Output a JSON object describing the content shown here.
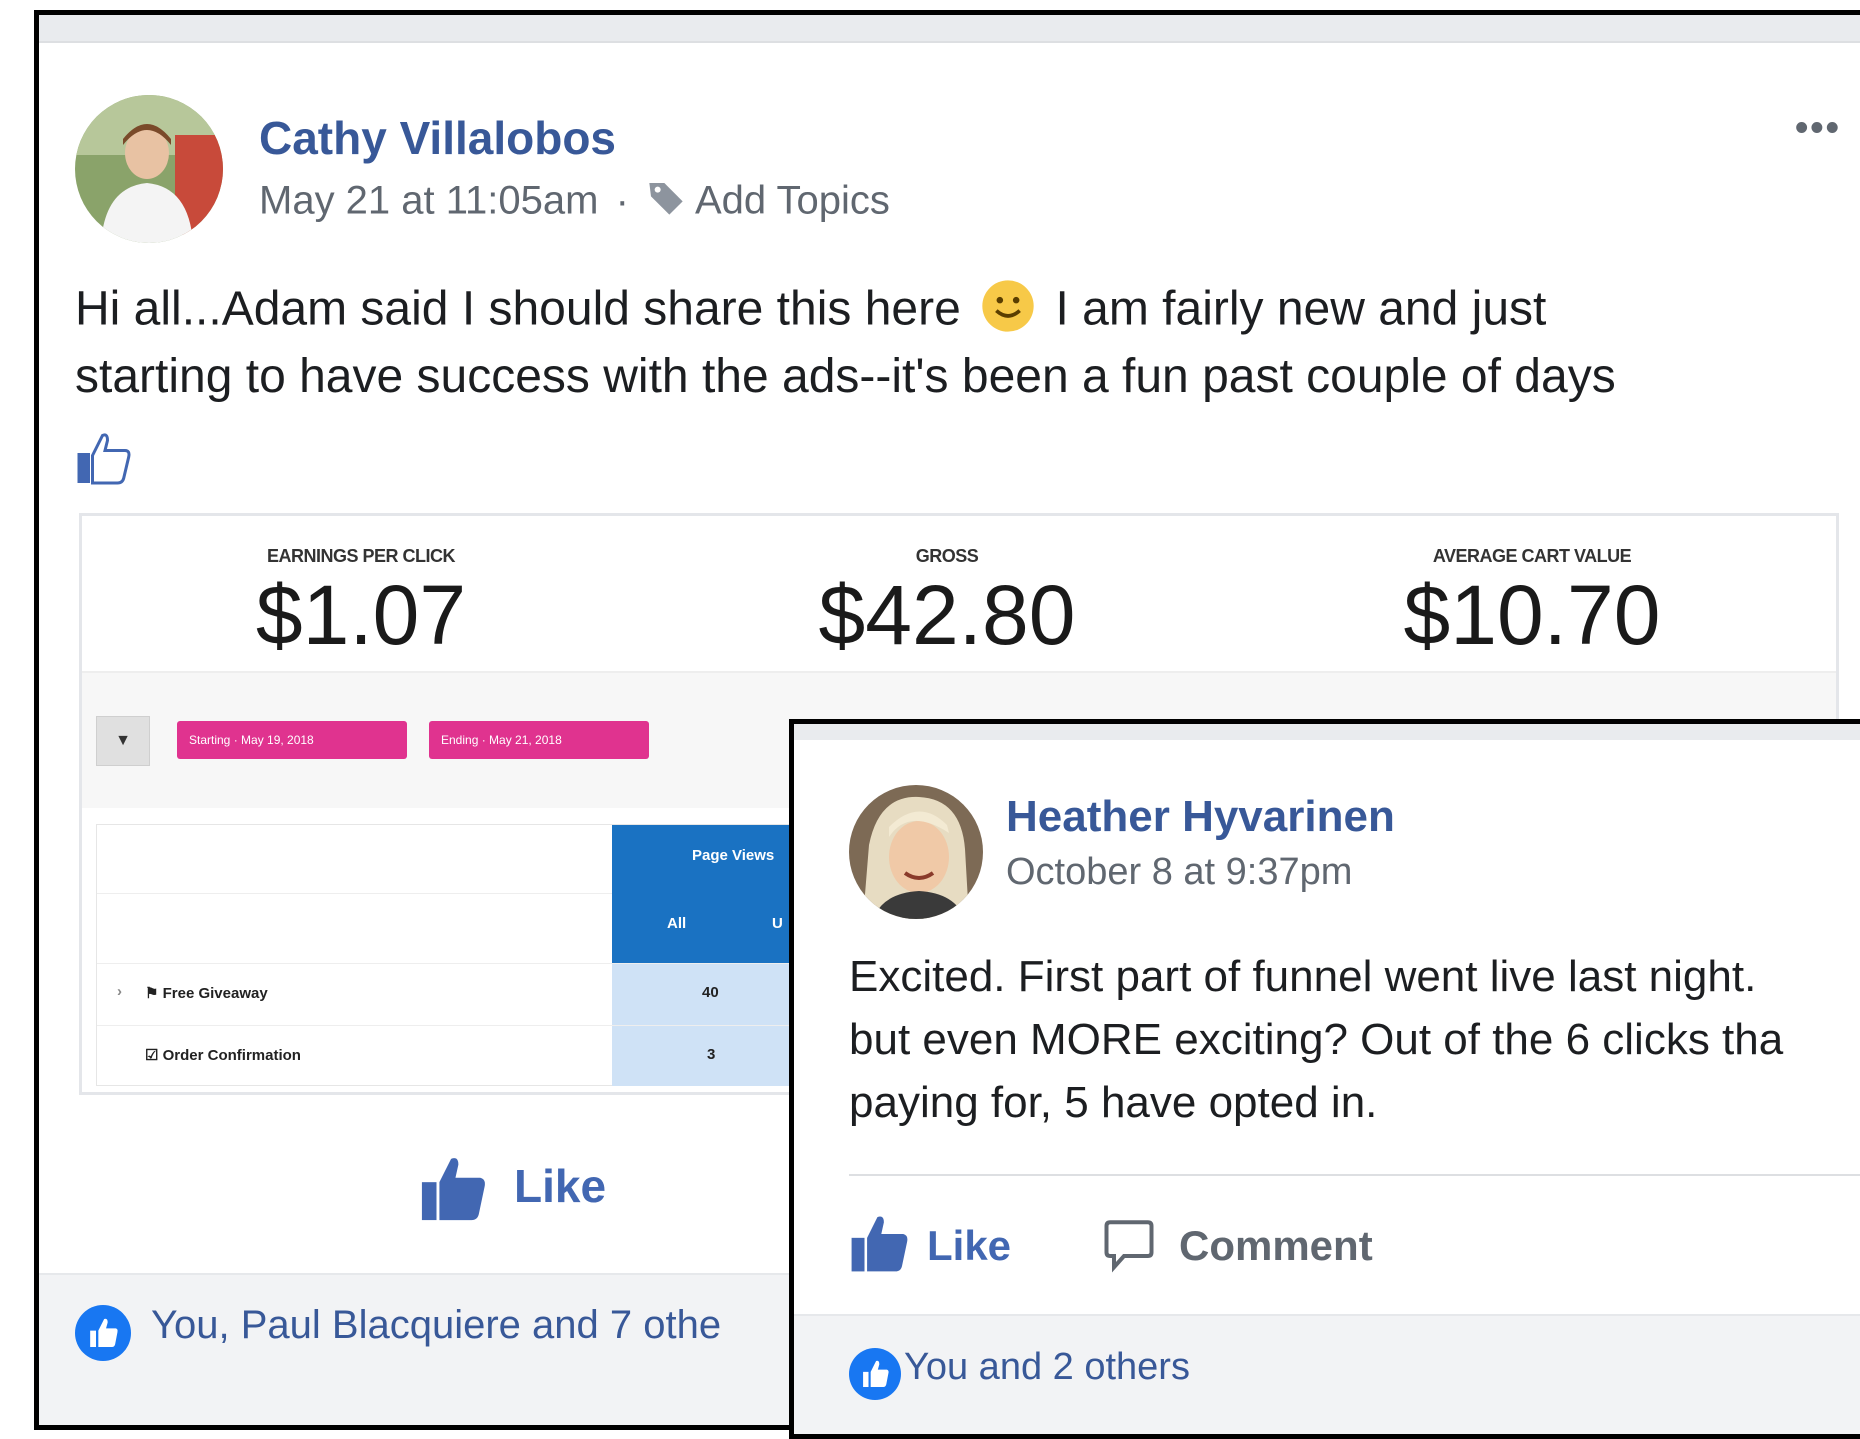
{
  "post1": {
    "author": "Cathy Villalobos",
    "timestamp": "May 21 at 11:05am",
    "separator": "·",
    "add_topics": "Add Topics",
    "text_line1": "Hi all...Adam said I should share this here",
    "text_line1_after": "I am fairly new and just",
    "text_line2": "starting to have success with the ads--it's been a fun past couple of days",
    "stats": [
      {
        "label": "EARNINGS PER CLICK",
        "value": "$1.07"
      },
      {
        "label": "GROSS",
        "value": "$42.80"
      },
      {
        "label": "AVERAGE CART VALUE",
        "value": "$10.70"
      }
    ],
    "filter_icon": "filter-icon",
    "date_pills": [
      "Starting · May 19, 2018",
      "Ending · May 21, 2018"
    ],
    "table": {
      "header": "Page Views",
      "subheaders": [
        "All",
        "U"
      ],
      "rows": [
        {
          "label": "Free Giveaway",
          "value": "40"
        },
        {
          "label": "Order Confirmation",
          "value": "3"
        }
      ]
    },
    "like_label": "Like",
    "reactions_text": "You, Paul Blacquiere and 7 othe"
  },
  "post2": {
    "author": "Heather Hyvarinen",
    "timestamp": "October 8 at 9:37pm",
    "text_lines": [
      "Excited. First part of funnel went live last night.",
      "but even MORE exciting? Out of the 6 clicks tha",
      "paying for, 5 have opted in."
    ],
    "like_label": "Like",
    "comment_label": "Comment",
    "reactions_text": "You and 2 others"
  },
  "colors": {
    "link_blue": "#385898",
    "like_blue": "#4267b2",
    "pill_pink": "#e0338f",
    "table_blue": "#1a72c2"
  }
}
